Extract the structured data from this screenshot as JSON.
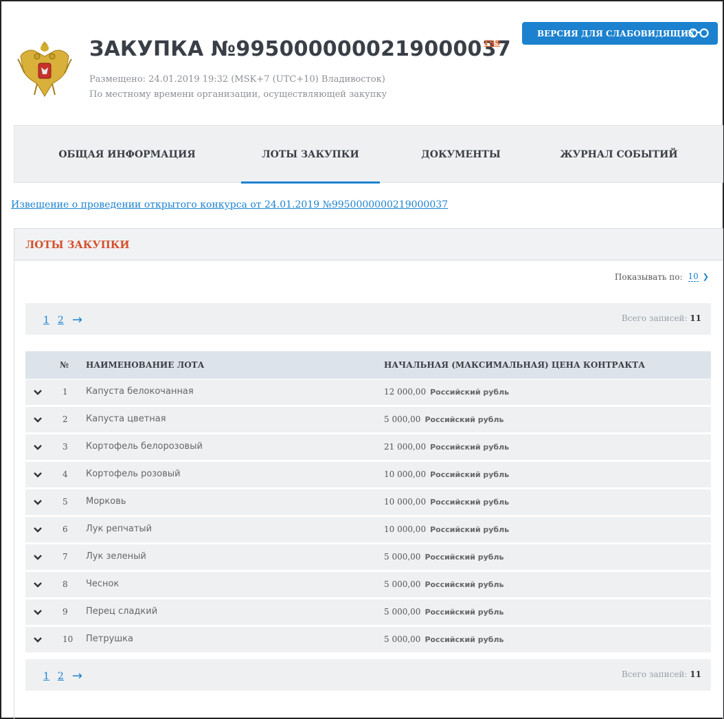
{
  "header": {
    "title": "ЗАКУПКА №9950000000219000037",
    "rss_label": "rss",
    "posted": "Размещено: 24.01.2019 19:32 (MSK+7 (UTC+10) Владивосток)",
    "timezone_note": "По местному времени организации, осуществляющей закупку",
    "visually_impaired_label": "ВЕРСИЯ ДЛЯ СЛАБОВИДЯЩИХ"
  },
  "tabs": [
    {
      "label": "ОБЩАЯ ИНФОРМАЦИЯ",
      "active": false
    },
    {
      "label": "ЛОТЫ ЗАКУПКИ",
      "active": true
    },
    {
      "label": "ДОКУМЕНТЫ",
      "active": false
    },
    {
      "label": "ЖУРНАЛ СОБЫТИЙ",
      "active": false
    }
  ],
  "notice_link": "Извещение о проведении открытого конкурса от 24.01.2019 №9950000000219000037",
  "panel": {
    "title": "ЛОТЫ ЗАКУПКИ",
    "show_by_label": "Показывать по:",
    "show_by_value": "10",
    "pages": [
      "1",
      "2"
    ],
    "total_label": "Всего записей:",
    "total_value": "11",
    "columns": {
      "num": "№",
      "name": "НАИМЕНОВАНИЕ ЛОТА",
      "price": "НАЧАЛЬНАЯ (МАКСИМАЛЬНАЯ) ЦЕНА КОНТРАКТА"
    },
    "rows": [
      {
        "num": "1",
        "name": "Капуста белокочанная",
        "price": "12 000,00",
        "currency": "Российский рубль"
      },
      {
        "num": "2",
        "name": "Капуста цветная",
        "price": "5 000,00",
        "currency": "Российский рубль"
      },
      {
        "num": "3",
        "name": "Кортофель белорозовый",
        "price": "21 000,00",
        "currency": "Российский рубль"
      },
      {
        "num": "4",
        "name": "Кортофель розовый",
        "price": "10 000,00",
        "currency": "Российский рубль"
      },
      {
        "num": "5",
        "name": "Морковь",
        "price": "10 000,00",
        "currency": "Российский рубль"
      },
      {
        "num": "6",
        "name": "Лук репчатый",
        "price": "10 000,00",
        "currency": "Российский рубль"
      },
      {
        "num": "7",
        "name": "Лук зеленый",
        "price": "5 000,00",
        "currency": "Российский рубль"
      },
      {
        "num": "8",
        "name": "Чеснок",
        "price": "5 000,00",
        "currency": "Российский рубль"
      },
      {
        "num": "9",
        "name": "Перец сладкий",
        "price": "5 000,00",
        "currency": "Российский рубль"
      },
      {
        "num": "10",
        "name": "Петрушка",
        "price": "5 000,00",
        "currency": "Российский рубль"
      }
    ]
  },
  "colors": {
    "accent": "#1c82cf",
    "panel_title": "#d4502c",
    "rss": "#e8652f"
  },
  "icons": {
    "emblem": "russian-coat-of-arms",
    "glasses": "glasses-icon",
    "expand": "chevron-down-icon",
    "next": "arrow-right-icon"
  }
}
